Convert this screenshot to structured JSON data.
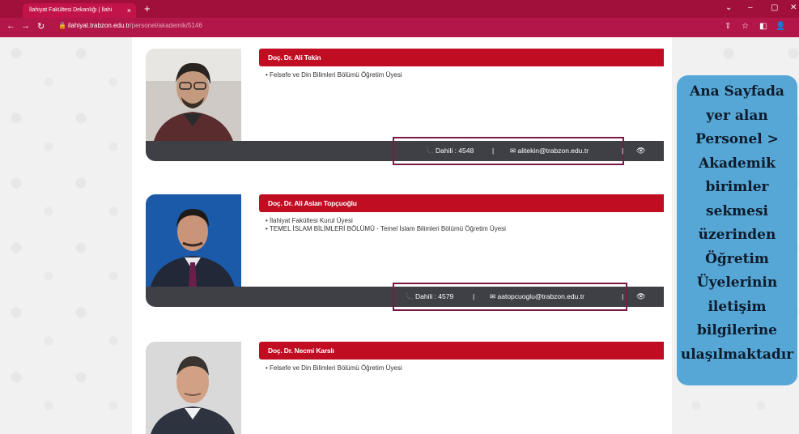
{
  "browser": {
    "tab_title": "İlahiyat Fakültesi Dekanlığı | İlahi",
    "tab_close": "×",
    "new_tab": "+",
    "url_host": "ilahiyat.trabzon.edu.tr",
    "url_path": "/personel/akademik/5146"
  },
  "people": [
    {
      "name": "Doç. Dr. Ali Tekin",
      "roles": [
        "Felsefe ve Din Bilimleri Bölümü Öğretim Üyesi"
      ],
      "phone": "Dahili : 4548",
      "email": "alitekin@trabzon.edu.tr"
    },
    {
      "name": "Doç. Dr. Ali Aslan Topçuoğlu",
      "roles": [
        "İlahiyat Fakültesi Kurul Üyesi",
        "TEMEL İSLAM BİLİMLERİ BÖLÜMÜ - Temel İslam Bilimleri Bölümü Öğretim Üyesi"
      ],
      "phone": "Dahili : 4579",
      "email": "aatopcuoglu@trabzon.edu.tr"
    },
    {
      "name": "Doç. Dr. Necmi Karslı",
      "roles": [
        "Felsefe ve Din Bilimleri Bölümü Öğretim Üyesi"
      ]
    }
  ],
  "separator": "|",
  "callout_lines": [
    "Ana Sayfada",
    "yer alan",
    "Personel >",
    "Akademik",
    "birimler",
    "sekmesi",
    "üzerinden",
    "Öğretim",
    "Üyelerinin",
    "iletişim",
    "bilgilerine",
    "ulaşılmaktadır"
  ],
  "colors": {
    "tab_bar": "#a0103a",
    "name_bar": "#c00d22",
    "contact_bar": "#3e4046",
    "highlight": "#7b1a45",
    "callout": "#56a6d6"
  }
}
